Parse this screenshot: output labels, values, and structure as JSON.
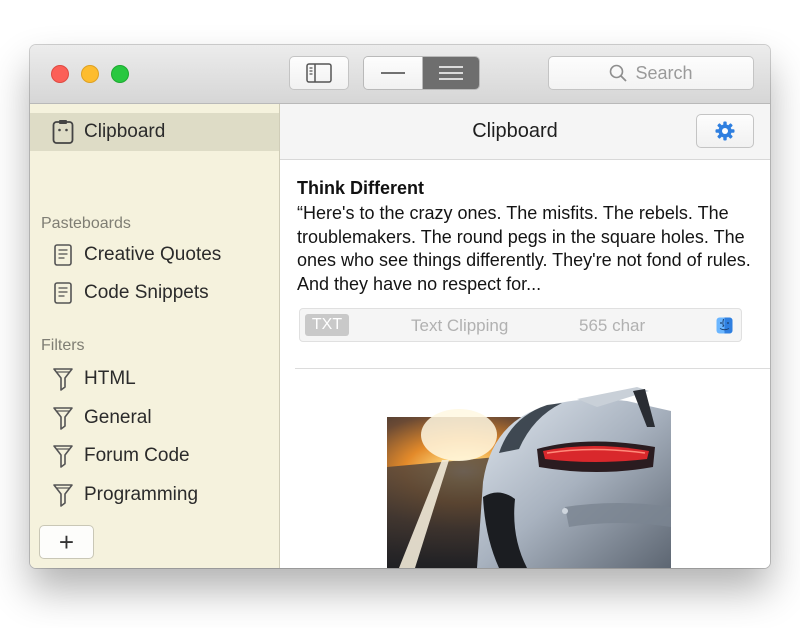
{
  "toolbar": {
    "search_placeholder": "Search"
  },
  "sidebar": {
    "selected_item": "Clipboard",
    "pasteboards_header": "Pasteboards",
    "pasteboards": [
      "Creative Quotes",
      "Code Snippets"
    ],
    "filters_header": "Filters",
    "filters": [
      "HTML",
      "General",
      "Forum Code",
      "Programming"
    ],
    "add_label": "+"
  },
  "main": {
    "title": "Clipboard",
    "clip": {
      "title": "Think Different",
      "body": "“Here's to the crazy ones. The misfits. The rebels. The troublemakers. The round pegs in the square holes. The ones who see things differently. They're not fond of rules. And they have no respect for...",
      "badge": "TXT",
      "type": "Text Clipping",
      "chars": "565 char"
    }
  },
  "colors": {
    "sidebar_bg": "#f5f2dd",
    "sidebar_selected": "#dedcc6",
    "accent_blue": "#2f7fe0"
  }
}
